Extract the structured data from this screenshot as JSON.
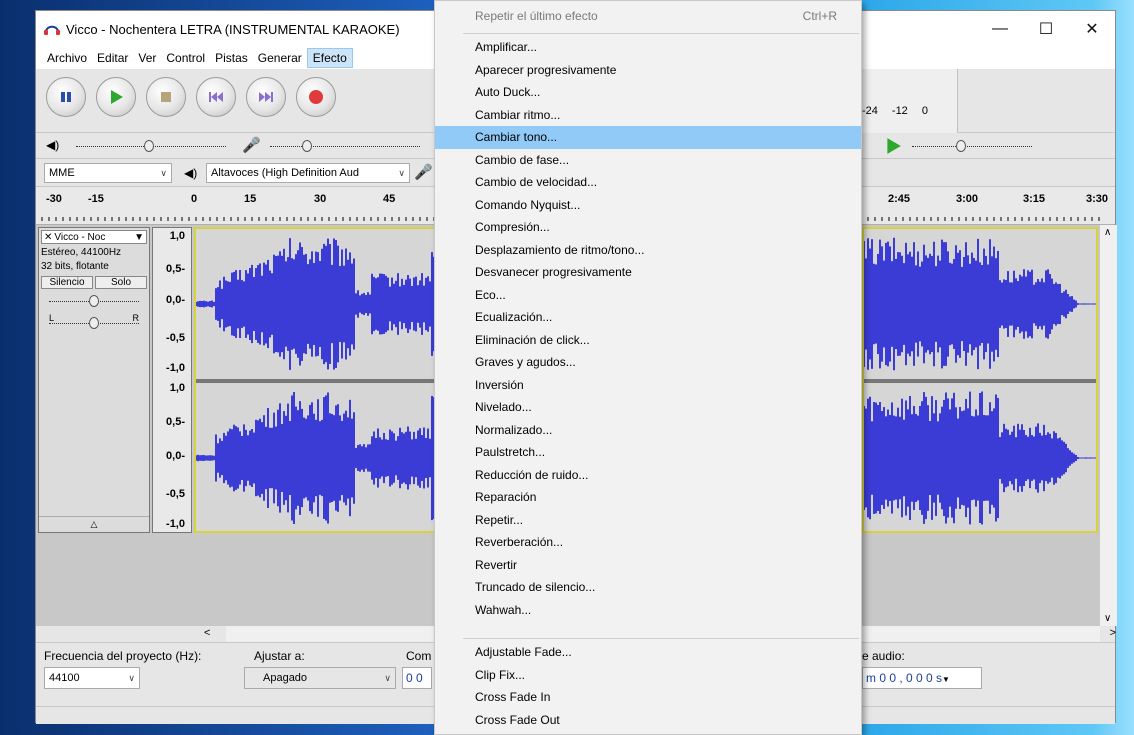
{
  "window": {
    "title": "Vicco - Nochentera LETRA (INSTRUMENTAL KARAOKE)",
    "minimize": "—",
    "maximize": "☐",
    "close": "✕"
  },
  "menubar": [
    "Archivo",
    "Editar",
    "Ver",
    "Control",
    "Pistas",
    "Generar",
    "Efecto"
  ],
  "toolbar": {
    "meter_ticks": [
      "-24",
      "-12",
      "0"
    ]
  },
  "devices": {
    "host": "MME",
    "output": "Altavoces (High Definition Aud"
  },
  "ruler": {
    "left_ticks": [
      "-30",
      "-15",
      "0",
      "15",
      "30",
      "45"
    ],
    "right_ticks": [
      "2:45",
      "3:00",
      "3:15",
      "3:30"
    ]
  },
  "track": {
    "name": "Vicco - Noc",
    "info1": "Estéreo, 44100Hz",
    "info2": "32 bits, flotante",
    "mute": "Silencio",
    "solo": "Solo",
    "pan_left": "L",
    "pan_right": "R",
    "scale": [
      "1,0",
      "0,5-",
      "0,0-",
      "-0,5",
      "-1,0"
    ]
  },
  "bottom": {
    "rate_label": "Frecuencia del proyecto (Hz):",
    "rate_value": "44100",
    "snap_label": "Ajustar a:",
    "snap_value": "Apagado",
    "com_label": "Com",
    "sel_start": "0 0",
    "audio_label": "e audio:",
    "audio_time": "m 0 0 , 0 0 0 s"
  },
  "menu": {
    "repeat_last": "Repetir el último efecto",
    "repeat_shortcut": "Ctrl+R",
    "items": [
      "Amplificar...",
      "Aparecer progresivamente",
      "Auto Duck...",
      "Cambiar ritmo...",
      "Cambiar tono...",
      "Cambio de fase...",
      "Cambio de velocidad...",
      "Comando Nyquist...",
      "Compresión...",
      "Desplazamiento de ritmo/tono...",
      "Desvanecer progresivamente",
      "Eco...",
      "Ecualización...",
      "Eliminación de click...",
      "Graves y agudos...",
      "Inversión",
      "Nivelado...",
      "Normalizado...",
      "Paulstretch...",
      "Reducción de ruido...",
      "Reparación",
      "Repetir...",
      "Reverberación...",
      "Revertir",
      "Truncado de silencio...",
      "Wahwah..."
    ],
    "plugin_items": [
      "Adjustable Fade...",
      "Clip Fix...",
      "Cross Fade In",
      "Cross Fade Out"
    ],
    "highlighted": "Cambiar tono..."
  },
  "colors": {
    "waveform": "#3b3bd6",
    "highlight": "#91c9f7",
    "selection_border": "#d8d23c"
  }
}
